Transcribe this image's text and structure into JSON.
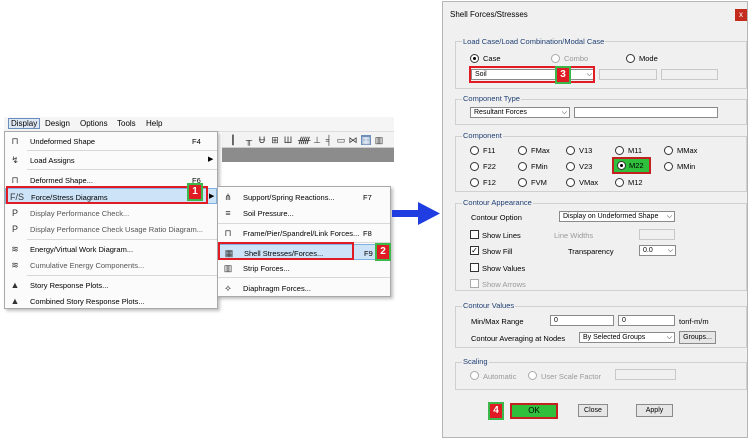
{
  "menubar": {
    "items": [
      "Display",
      "Design",
      "Options",
      "Tools",
      "Help"
    ]
  },
  "display_menu": {
    "items": [
      {
        "label": "Undeformed Shape",
        "shortcut": "F4",
        "icon": "frame-icon"
      },
      {
        "label": "Load Assigns",
        "shortcut": "",
        "icon": "load-icon",
        "submenu": true
      },
      {
        "label": "Deformed Shape...",
        "shortcut": "F6",
        "icon": "deformed-icon"
      },
      {
        "label": "Force/Stress Diagrams",
        "shortcut": "",
        "icon": "force-icon",
        "submenu": true
      },
      {
        "label": "Display Performance Check...",
        "shortcut": "",
        "icon": "performance-icon"
      },
      {
        "label": "Display Performance Check Usage Ratio Diagram...",
        "shortcut": "",
        "icon": "performance-ratio-icon"
      },
      {
        "label": "Energy/Virtual Work Diagram...",
        "shortcut": "",
        "icon": "energy-icon"
      },
      {
        "label": "Cumulative Energy Components...",
        "shortcut": "",
        "icon": "cumulative-icon"
      },
      {
        "label": "Story Response Plots...",
        "shortcut": "",
        "icon": "story-icon"
      },
      {
        "label": "Combined Story Response Plots...",
        "shortcut": "",
        "icon": "combined-story-icon"
      }
    ]
  },
  "force_submenu": {
    "items": [
      {
        "label": "Support/Spring Reactions...",
        "shortcut": "F7"
      },
      {
        "label": "Soil Pressure...",
        "shortcut": ""
      },
      {
        "label": "Frame/Pier/Spandrel/Link Forces...",
        "shortcut": "F8"
      },
      {
        "label": "Shell Stresses/Forces...",
        "shortcut": "F9"
      },
      {
        "label": "Strip Forces...",
        "shortcut": ""
      },
      {
        "label": "Diaphragm Forces...",
        "shortcut": ""
      }
    ]
  },
  "badges": [
    "1",
    "2",
    "3",
    "4"
  ],
  "dialog": {
    "title": "Shell Forces/Stresses",
    "close": "x",
    "load_case": {
      "title": "Load Case/Load Combination/Modal Case",
      "options": [
        "Case",
        "Combo",
        "Mode"
      ],
      "selected": "Case",
      "value": "Soil"
    },
    "component_type": {
      "title": "Component Type",
      "value": "Resultant Forces"
    },
    "component": {
      "title": "Component",
      "options": [
        "F11",
        "FMax",
        "V13",
        "M11",
        "MMax",
        "F22",
        "FMin",
        "V23",
        "M22",
        "MMin",
        "F12",
        "FVM",
        "VMax",
        "M12"
      ],
      "selected": "M22"
    },
    "contour_appearance": {
      "title": "Contour Appearance",
      "contour_option_label": "Contour Option",
      "contour_option_value": "Display on Undeformed Shape",
      "show_lines": "Show Lines",
      "line_widths": "Line Widths",
      "show_fill": "Show Fill",
      "show_fill_checked": true,
      "transparency_label": "Transparency",
      "transparency_value": "0.0",
      "show_values": "Show Values",
      "show_arrows": "Show Arrows"
    },
    "contour_values": {
      "title": "Contour Values",
      "range_label": "Min/Max Range",
      "min": "0",
      "max": "0",
      "units": "tonf-m/m",
      "averaging_label": "Contour Averaging at Nodes",
      "averaging_value": "By Selected Groups",
      "groups_button": "Groups..."
    },
    "scaling": {
      "title": "Scaling",
      "automatic": "Automatic",
      "user": "User Scale Factor"
    },
    "buttons": {
      "ok": "OK",
      "close": "Close",
      "apply": "Apply"
    }
  }
}
